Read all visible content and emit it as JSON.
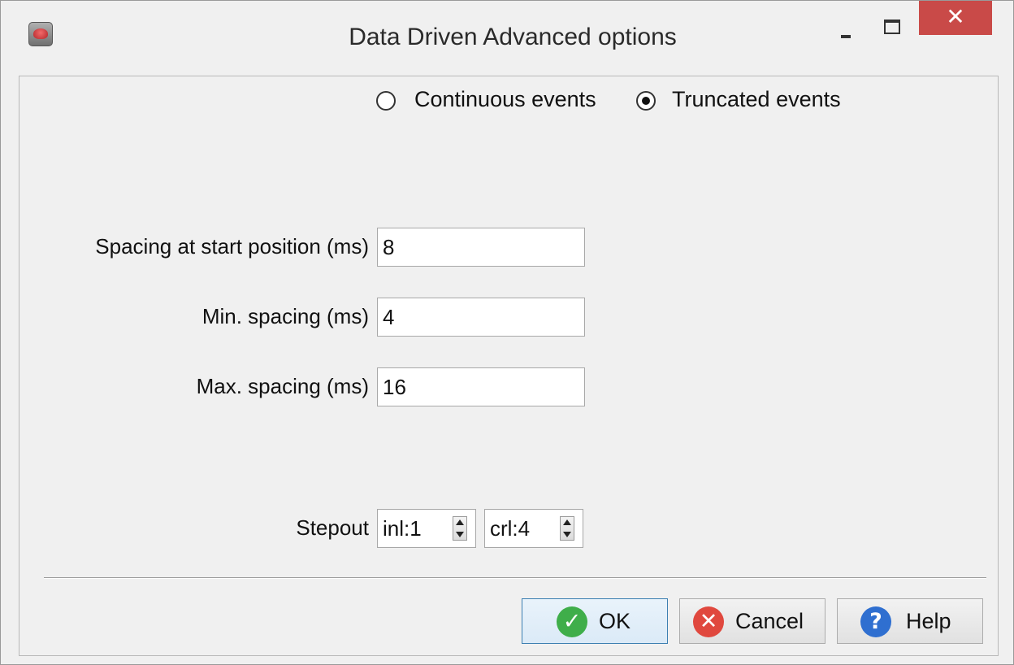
{
  "window": {
    "title": "Data Driven Advanced options",
    "close_glyph": "✕"
  },
  "event_mode": {
    "options": [
      {
        "label": "Continuous events",
        "selected": false
      },
      {
        "label": "Truncated events",
        "selected": true
      }
    ]
  },
  "fields": {
    "spacing_start": {
      "label": "Spacing at start position (ms)",
      "value": "8"
    },
    "min_spacing": {
      "label": "Min. spacing (ms)",
      "value": "4"
    },
    "max_spacing": {
      "label": "Max. spacing (ms)",
      "value": "16"
    }
  },
  "stepout": {
    "label": "Stepout",
    "inline": "inl:1",
    "crossline": "crl:4"
  },
  "buttons": {
    "ok": {
      "label": "OK",
      "icon": "check-icon",
      "color": "#3fae4a",
      "glyph": "✓"
    },
    "cancel": {
      "label": "Cancel",
      "icon": "cancel-x-icon",
      "color": "#e0483e",
      "glyph": "✕"
    },
    "help": {
      "label": "Help",
      "icon": "help-question-icon",
      "color": "#2f6fd0",
      "glyph": "?"
    }
  },
  "colors": {
    "close_button": "#c94a48",
    "default_button_border": "#3c7fb1"
  }
}
